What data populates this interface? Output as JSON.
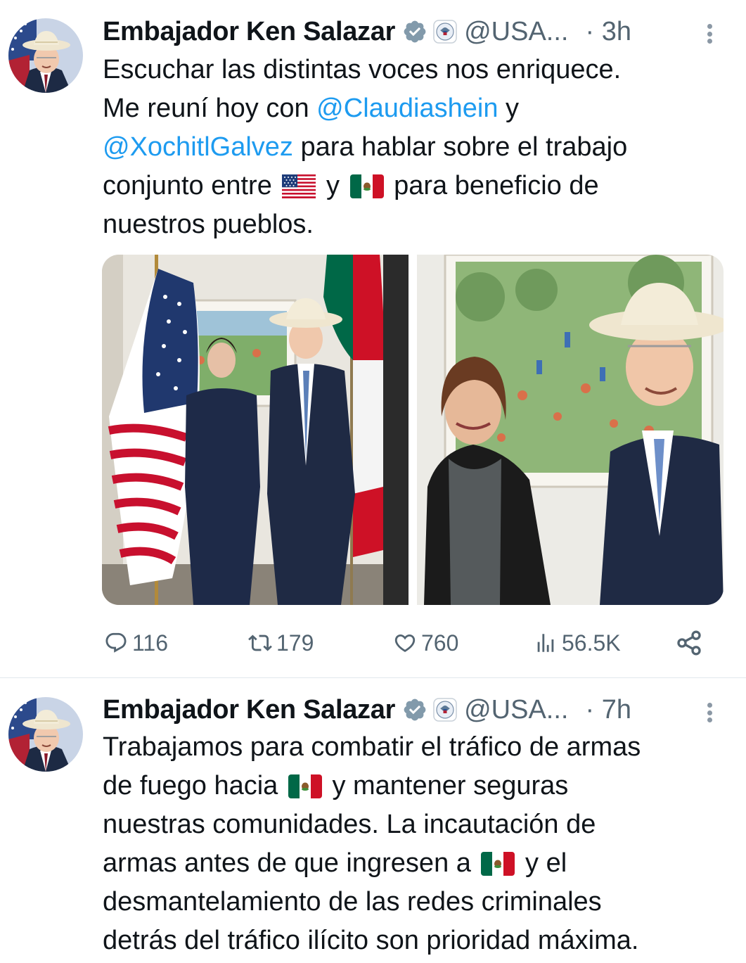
{
  "tweets": [
    {
      "author_name": "Embajador Ken Salazar",
      "handle": "@USA...",
      "time": "· 3h",
      "text_segments": [
        "Escuchar las distintas voces nos enriquece.",
        "Me reuní hoy con ",
        "@Claudiashein",
        " y",
        "@XochitlGalvez",
        " para hablar sobre el trabajo",
        "conjunto entre ",
        " y ",
        " para beneficio de",
        "nuestros pueblos."
      ],
      "stats": {
        "replies": "116",
        "retweets": "179",
        "likes": "760",
        "views": "56.5K"
      }
    },
    {
      "author_name": "Embajador Ken Salazar",
      "handle": "@USA...",
      "time": "· 7h",
      "text_segments": [
        "Trabajamos para combatir el tráfico de armas",
        "de fuego hacia ",
        " y mantener seguras",
        "nuestras comunidades. La incautación de",
        "armas antes de que ingresen a ",
        " y el",
        "desmantelamiento de las redes criminales",
        "detrás del tráfico ilícito son prioridad máxima."
      ]
    }
  ],
  "icons": {
    "verified": "verified-badge-icon",
    "affiliation": "us-seal-icon",
    "more": "more-options-icon",
    "reply": "reply-icon",
    "retweet": "retweet-icon",
    "like": "heart-icon",
    "views": "views-chart-icon",
    "share": "share-icon",
    "flag_us": "us-flag-emoji",
    "flag_mx": "mexico-flag-emoji"
  },
  "colors": {
    "mention": "#1d9bf0",
    "secondary_text": "#536471",
    "primary_text": "#0f1419",
    "divider": "#e1e8ed"
  }
}
